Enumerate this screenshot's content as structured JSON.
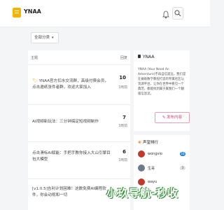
{
  "header": {
    "site_name": "YNAA"
  },
  "filter": {
    "label": "全部分类"
  },
  "topic_list": {
    "col_topic": "主题",
    "col_replies": "回复",
    "rows": [
      {
        "title": "YNAA官方扣水交流群，高级付费会员，点击邀纸张件者群，欢迎大家加入",
        "replies": "10",
        "time": "3周前"
      },
      {
        "title": "AI视频新玩法：三分钟搞定短视频制作",
        "replies": "7",
        "time": "3周前"
      },
      {
        "title": "点击滑标AI赋能：手把手教你接入大山引擎目包大模型",
        "replies": "6",
        "time": "3周前"
      },
      {
        "title": "[v1.0.5]吉利计划困难！这数免费AI编程软件，你会动视和一切",
        "replies": "",
        "time": ""
      }
    ]
  },
  "about": {
    "title": "YNAA",
    "desc": "YNAA (Your Need An Adventure)不再自信遥远，我们是在做助数学教程打造的专属社区与资源平台，让你在世界中看见一个典范，都能找到属于属我们一个翻版信息流。",
    "post_button": "发布内容"
  },
  "ranking": {
    "title": "声望排行",
    "items": [
      {
        "name": "wongvio",
        "score": "16"
      },
      {
        "name": "生哥",
        "score": "3"
      },
      {
        "name": "wayu",
        "score": ""
      }
    ]
  },
  "watermark": {
    "text": "小玖导航-秒收"
  },
  "colors": {
    "accent": "#f5b400",
    "post": "#d2406a",
    "badge": "#2e86de"
  }
}
